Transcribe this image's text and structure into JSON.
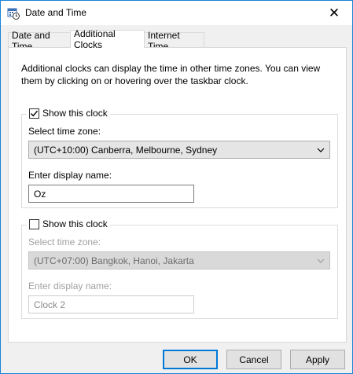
{
  "window": {
    "title": "Date and Time",
    "close_glyph": "✕"
  },
  "tabs": [
    {
      "label": "Date and Time",
      "active": false
    },
    {
      "label": "Additional Clocks",
      "active": true
    },
    {
      "label": "Internet Time",
      "active": false
    }
  ],
  "intro_text": "Additional clocks can display the time in other time zones. You can view them by clicking on or hovering over the taskbar clock.",
  "clock1": {
    "show_label": "Show this clock",
    "checked": true,
    "timezone_label": "Select time zone:",
    "timezone_value": "(UTC+10:00) Canberra, Melbourne, Sydney",
    "name_label": "Enter display name:",
    "name_value": "Oz"
  },
  "clock2": {
    "show_label": "Show this clock",
    "checked": false,
    "timezone_label": "Select time zone:",
    "timezone_value": "(UTC+07:00) Bangkok, Hanoi, Jakarta",
    "name_label": "Enter display name:",
    "name_value": "Clock 2"
  },
  "buttons": {
    "ok": "OK",
    "cancel": "Cancel",
    "apply": "Apply"
  },
  "colors": {
    "accent": "#0078d7",
    "window_border": "#1883d7"
  }
}
